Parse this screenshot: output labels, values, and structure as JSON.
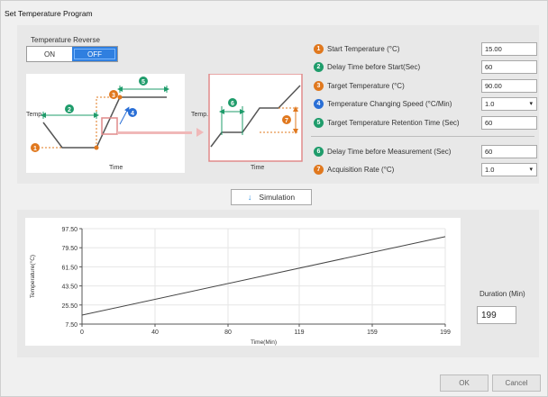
{
  "window": {
    "title": "Set Temperature Program"
  },
  "reverse": {
    "label": "Temperature Reverse",
    "on": "ON",
    "off": "OFF",
    "selected": "OFF"
  },
  "diagram": {
    "y_label": "Temp.",
    "x_label": "Time",
    "zoom_y_label": "Temp.",
    "zoom_x_label": "Time",
    "badges": [
      "1",
      "2",
      "3",
      "4",
      "5",
      "6",
      "7"
    ]
  },
  "params": [
    {
      "num": "1",
      "color": "#e0781e",
      "label": "Start Temperature (°C)",
      "value": "15.00",
      "kind": "input"
    },
    {
      "num": "2",
      "color": "#1f9c6b",
      "label": "Delay Time before Start(Sec)",
      "value": "60",
      "kind": "input"
    },
    {
      "num": "3",
      "color": "#e0781e",
      "label": "Target Temperature (°C)",
      "value": "90.00",
      "kind": "input"
    },
    {
      "num": "4",
      "color": "#2a6fd6",
      "label": "Temperature Changing Speed (°C/Min)",
      "value": "1.0",
      "kind": "select"
    },
    {
      "num": "5",
      "color": "#1f9c6b",
      "label": "Target Temperature Retention Time (Sec)",
      "value": "60",
      "kind": "input"
    },
    {
      "num": "6",
      "color": "#1f9c6b",
      "label": "Delay Time before Measurement (Sec)",
      "value": "60",
      "kind": "input"
    },
    {
      "num": "7",
      "color": "#e0781e",
      "label": "Acquisition Rate (°C)",
      "value": "1.0",
      "kind": "select"
    }
  ],
  "simulation": {
    "label": "Simulation"
  },
  "chart_data": {
    "type": "line",
    "title": "",
    "xlabel": "Time(Min)",
    "ylabel": "Temperature(°C)",
    "xticks": [
      "0",
      "40",
      "80",
      "119",
      "159",
      "199"
    ],
    "yticks": [
      "97.50",
      "79.50",
      "61.50",
      "43.50",
      "25.50",
      "7.50"
    ],
    "xlim": [
      0,
      199
    ],
    "ylim": [
      7.5,
      97.5
    ],
    "grid": true,
    "series": [
      {
        "x": [
          0,
          199
        ],
        "y": [
          16,
          90
        ]
      }
    ]
  },
  "duration": {
    "label": "Duration (Min)",
    "value": "199"
  },
  "buttons": {
    "ok": "OK",
    "cancel": "Cancel"
  },
  "colors": {
    "accent": "#2f7fe0",
    "orange": "#e0781e",
    "green": "#1f9c6b",
    "blue": "#2a6fd6",
    "highlight": "#e08a8a"
  }
}
